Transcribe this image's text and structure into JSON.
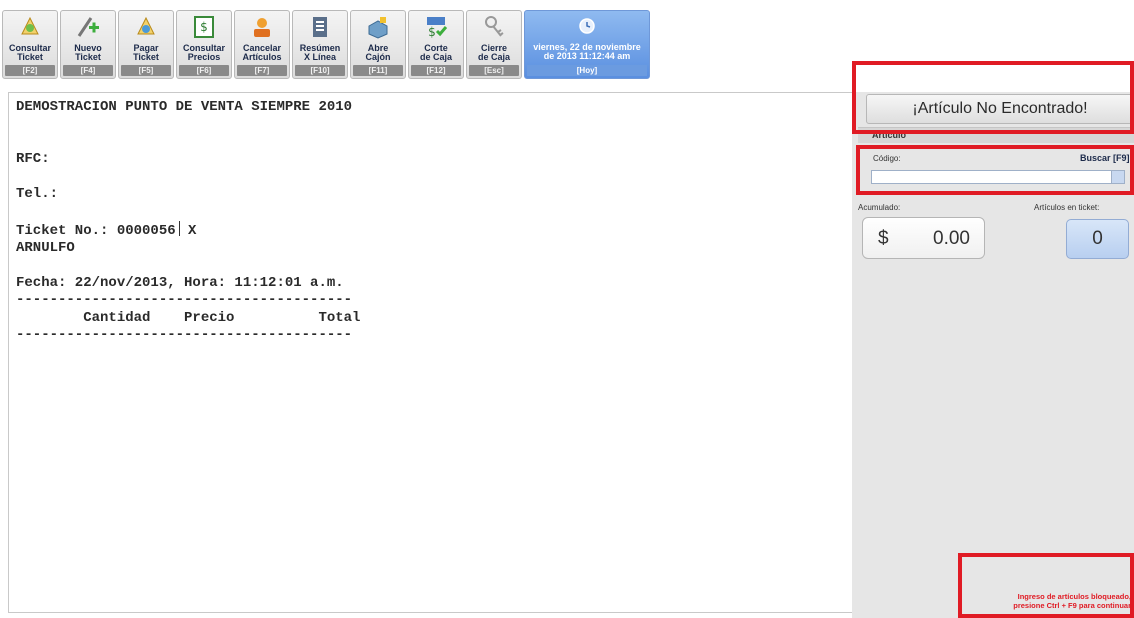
{
  "toolbar": {
    "buttons": [
      {
        "label": "Consultar\nTicket",
        "key": "[F2]",
        "icon": "ticket-search-icon"
      },
      {
        "label": "Nuevo\nTicket",
        "key": "[F4]",
        "icon": "new-ticket-icon"
      },
      {
        "label": "Pagar\nTicket",
        "key": "[F5]",
        "icon": "pay-ticket-icon"
      },
      {
        "label": "Consultar\nPrecios",
        "key": "[F6]",
        "icon": "price-lookup-icon"
      },
      {
        "label": "Cancelar\nArtículos",
        "key": "[F7]",
        "icon": "cancel-items-icon"
      },
      {
        "label": "Resúmen\nX Línea",
        "key": "[F10]",
        "icon": "summary-icon"
      },
      {
        "label": "Abre\nCajón",
        "key": "[F11]",
        "icon": "cash-drawer-icon"
      },
      {
        "label": "Corte\nde Caja",
        "key": "[F12]",
        "icon": "cash-cut-icon"
      },
      {
        "label": "Cierre\nde Caja",
        "key": "[Esc]",
        "icon": "close-register-icon"
      }
    ],
    "clock": {
      "label": "viernes, 22 de noviembre\nde 2013 11:12:44 am",
      "key": "[Hoy]",
      "icon": "clock-icon"
    }
  },
  "ticket": {
    "text": "DEMOSTRACION PUNTO DE VENTA SIEMPRE 2010\n\n\nRFC:\n\nTel.:\n\nTicket No.: 0000056",
    "text_after_caret": " X\nARNULFO\n\nFecha: 22/nov/2013, Hora: 11:12:01 a.m.\n----------------------------------------\n        Cantidad    Precio          Total\n----------------------------------------"
  },
  "right_panel": {
    "notfound": "¡Artículo No Encontrado!",
    "articulo_header": "Artículo",
    "codigo_label": "Código:",
    "buscar_label": "Buscar [F9]",
    "codigo_value": "",
    "acumulado_label": "Acumulado:",
    "acumulado_currency": "$",
    "acumulado_amount": "0.00",
    "articulos_label": "Artículos en ticket:",
    "articulos_count": "0",
    "blocked_line1": "Ingreso de artículos bloqueado,",
    "blocked_line2": "presione Ctrl + F9 para continuar"
  },
  "colors": {
    "highlight_red": "#e01b24",
    "clock_blue": "#5a8fe0",
    "panel_gray": "#e6e6e6"
  }
}
